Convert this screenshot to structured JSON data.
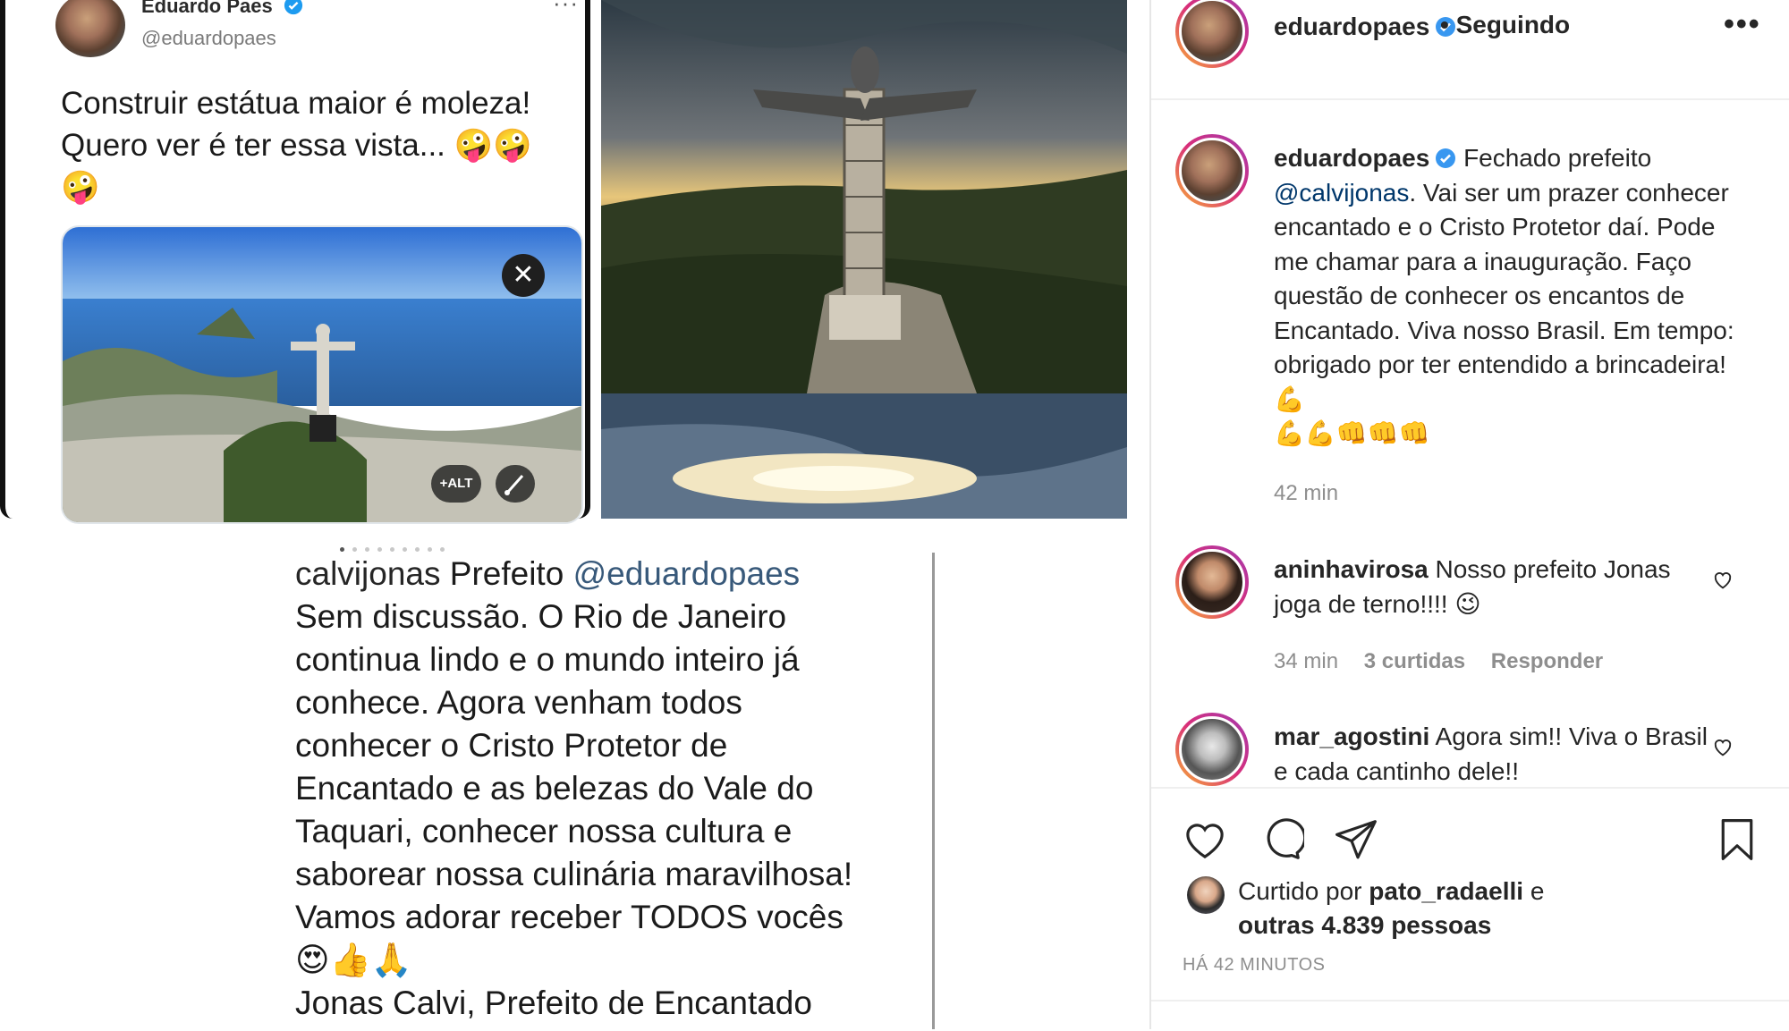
{
  "tweet": {
    "author_name": "Eduardo Paes",
    "author_handle": "@eduardopaes",
    "more": "···",
    "text_line1": "Construir estátua maior é moleza!",
    "text_line2": "Quero ver é ter essa vista... 🤪🤪",
    "text_line3": "🤪",
    "close": "✕",
    "alt_badge": "+ALT"
  },
  "instagram_screenshot": {
    "username": "calvijonas",
    "mention": "@eduardopaes",
    "first_word": "Prefeito",
    "lines": [
      "Sem discussão. O Rio de Janeiro",
      "continua lindo e o mundo inteiro já",
      "conhece. Agora venham todos",
      "conhecer o Cristo Protetor de",
      "Encantado e as belezas do Vale do",
      "Taquari, conhecer nossa cultura e",
      "saborear nossa culinária maravilhosa!",
      "Vamos adorar receber TODOS vocês",
      "😍👍🙏",
      "Jonas Calvi, Prefeito de Encantado"
    ]
  },
  "post": {
    "header": {
      "username": "eduardopaes",
      "follow_status": "• Seguindo",
      "more": "•••"
    },
    "caption": {
      "username": "eduardopaes",
      "lead": "Fechado prefeito",
      "mention": "@calvijonas",
      "body": ". Vai ser um prazer conhecer encantado e o Cristo Protetor daí. Pode me chamar para a inauguração. Faço questão de conhecer os encantos de Encantado. Viva nosso Brasil. Em tempo: obrigado por ter entendido a brincadeira! 💪",
      "emojis": "💪💪👊👊👊",
      "time": "42 min"
    },
    "comments": [
      {
        "username": "aninhavirosa",
        "text": "Nosso prefeito Jonas joga de terno!!!! 😉",
        "time": "34 min",
        "likes": "3 curtidas",
        "reply": "Responder"
      },
      {
        "username": "mar_agostini",
        "text": "Agora sim!! Viva o Brasil e cada cantinho dele!!"
      }
    ],
    "likes": {
      "prefix": "Curtido por",
      "user": "pato_radaelli",
      "mid": "e",
      "others": "outras 4.839 pessoas"
    },
    "time_ago": "HÁ 42 MINUTOS"
  },
  "colors": {
    "verified": "#3897f0",
    "mention": "#00376b",
    "muted": "#8e8e8e"
  }
}
